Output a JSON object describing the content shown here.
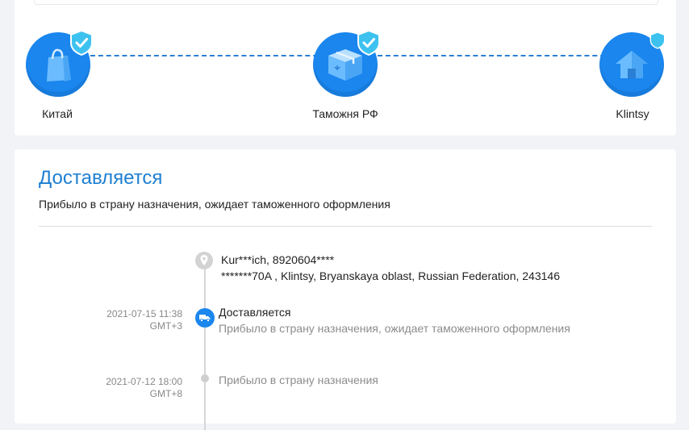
{
  "route": {
    "nodes": [
      {
        "label": "Китай",
        "icon": "shopping-bag-icon"
      },
      {
        "label": "Таможня РФ",
        "icon": "package-box-icon"
      },
      {
        "label": "Klintsy",
        "icon": "house-icon"
      }
    ],
    "badge_icon": "verified-shield-icon"
  },
  "status": {
    "title": "Доставляется",
    "subtitle": "Прибыло в страну назначения, ожидает таможенного оформления"
  },
  "address": {
    "line1": "Kur***ich,  8920604****",
    "line2": "*******70A ,  Klintsy,  Bryanskaya oblast,  Russian Federation,  243146"
  },
  "events": [
    {
      "date": "2021-07-15 11:38",
      "tz": "GMT+3",
      "title": "Доставляется",
      "desc": "Прибыло в страну назначения, ожидает таможенного оформления",
      "icon": "truck-icon"
    },
    {
      "date": "2021-07-12 18:00",
      "tz": "GMT+8",
      "desc": "Прибыло в страну назначения"
    }
  ],
  "colors": {
    "accent": "#1a86ee",
    "title_blue": "#1e7fd2",
    "badge": "#3dc2f0",
    "background": "#f2f3f7"
  }
}
